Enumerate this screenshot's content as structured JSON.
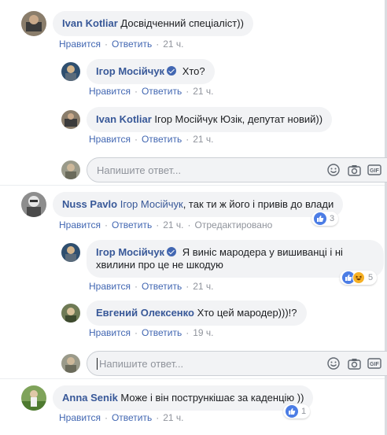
{
  "comments": [
    {
      "author": "Ivan Kotliar",
      "mention": "",
      "text": "Досвідченний спеціаліст))",
      "verified": false,
      "actions": {
        "like": "Нравится",
        "reply": "Ответить",
        "time": "21 ч.",
        "edited": ""
      }
    },
    {
      "author": "Ігор Мосійчук",
      "mention": "",
      "text": "Хто?",
      "verified": true,
      "actions": {
        "like": "Нравится",
        "reply": "Ответить",
        "time": "21 ч.",
        "edited": ""
      }
    },
    {
      "author": "Ivan Kotliar",
      "mention": "",
      "text": "Ігор Мосійчук Юзік, депутат новий))",
      "verified": false,
      "actions": {
        "like": "Нравится",
        "reply": "Ответить",
        "time": "21 ч.",
        "edited": ""
      }
    },
    {
      "author": "Nuss Pavlo",
      "mention": "Ігор Мосійчук",
      "text": ", так ти ж його і привів до влади",
      "verified": false,
      "reactions": {
        "count": "3"
      },
      "actions": {
        "like": "Нравится",
        "reply": "Ответить",
        "time": "21 ч.",
        "edited": "Отредактировано"
      }
    },
    {
      "author": "Ігор Мосійчук",
      "mention": "",
      "text_line1": "Я виніс мародера у вишиванці і ні",
      "text_line2": "хвилини про це не шкодую",
      "verified": true,
      "reactions": {
        "count": "5"
      },
      "actions": {
        "like": "Нравится",
        "reply": "Ответить",
        "time": "21 ч.",
        "edited": ""
      }
    },
    {
      "author": "Евгений Олексенко",
      "mention": "",
      "text": "Хто цей мародер)))!?",
      "verified": false,
      "actions": {
        "like": "Нравится",
        "reply": "Ответить",
        "time": "19 ч.",
        "edited": ""
      }
    },
    {
      "author": "Anna Senik",
      "mention": "",
      "text": "Може і він пострункішає за каденцію ))",
      "verified": false,
      "reactions": {
        "count": "1"
      },
      "actions": {
        "like": "Нравится",
        "reply": "Ответить",
        "time": "21 ч.",
        "edited": ""
      }
    }
  ],
  "reply_box": {
    "placeholder": "Напишите ответ..."
  },
  "icons": [
    "emoji-icon",
    "camera-icon",
    "gif-icon",
    "sticker-icon",
    "like-icon",
    "haha-icon",
    "verified-badge-icon"
  ],
  "colors": {
    "author": "#385898",
    "link": "#4267b2",
    "bubble": "#f2f3f5",
    "meta": "#90949c"
  }
}
